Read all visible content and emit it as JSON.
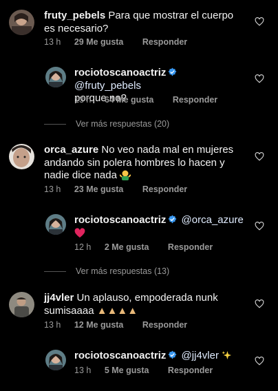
{
  "comments": [
    {
      "user": "fruty_pebels",
      "text": "Para que mostrar el cuerpo es necesario?",
      "time": "13 h",
      "likes": "29 Me gusta",
      "reply": "Responder"
    },
    {
      "user": "rociotoscanoactriz",
      "mention": "@fruty_pebels",
      "text": "porque no?",
      "time": "13 h",
      "likes": "64 Me gusta",
      "reply": "Responder"
    },
    {
      "user": "orca_azure",
      "text": "No veo nada mal en mujeres andando sin polera hombres lo hacen y nadie dice nada",
      "time": "13 h",
      "likes": "23 Me gusta",
      "reply": "Responder"
    },
    {
      "user": "rociotoscanoactriz",
      "mention": "@orca_azure",
      "time": "12 h",
      "likes": "2 Me gusta",
      "reply": "Responder"
    },
    {
      "user": "jj4vler",
      "text": "Un aplauso, empoderada nunk sumisaaaa",
      "time": "13 h",
      "likes": "12 Me gusta",
      "reply": "Responder"
    },
    {
      "user": "rociotoscanoactriz",
      "mention": "@jj4vler",
      "time": "13 h",
      "likes": "5 Me gusta",
      "reply": "Responder"
    }
  ],
  "view_more": [
    "Ver más respuestas (20)",
    "Ver más respuestas (13)"
  ],
  "colors": {
    "verified": "#3897f0",
    "heart_red": "#e0245e",
    "meta": "#9a9a9a"
  }
}
